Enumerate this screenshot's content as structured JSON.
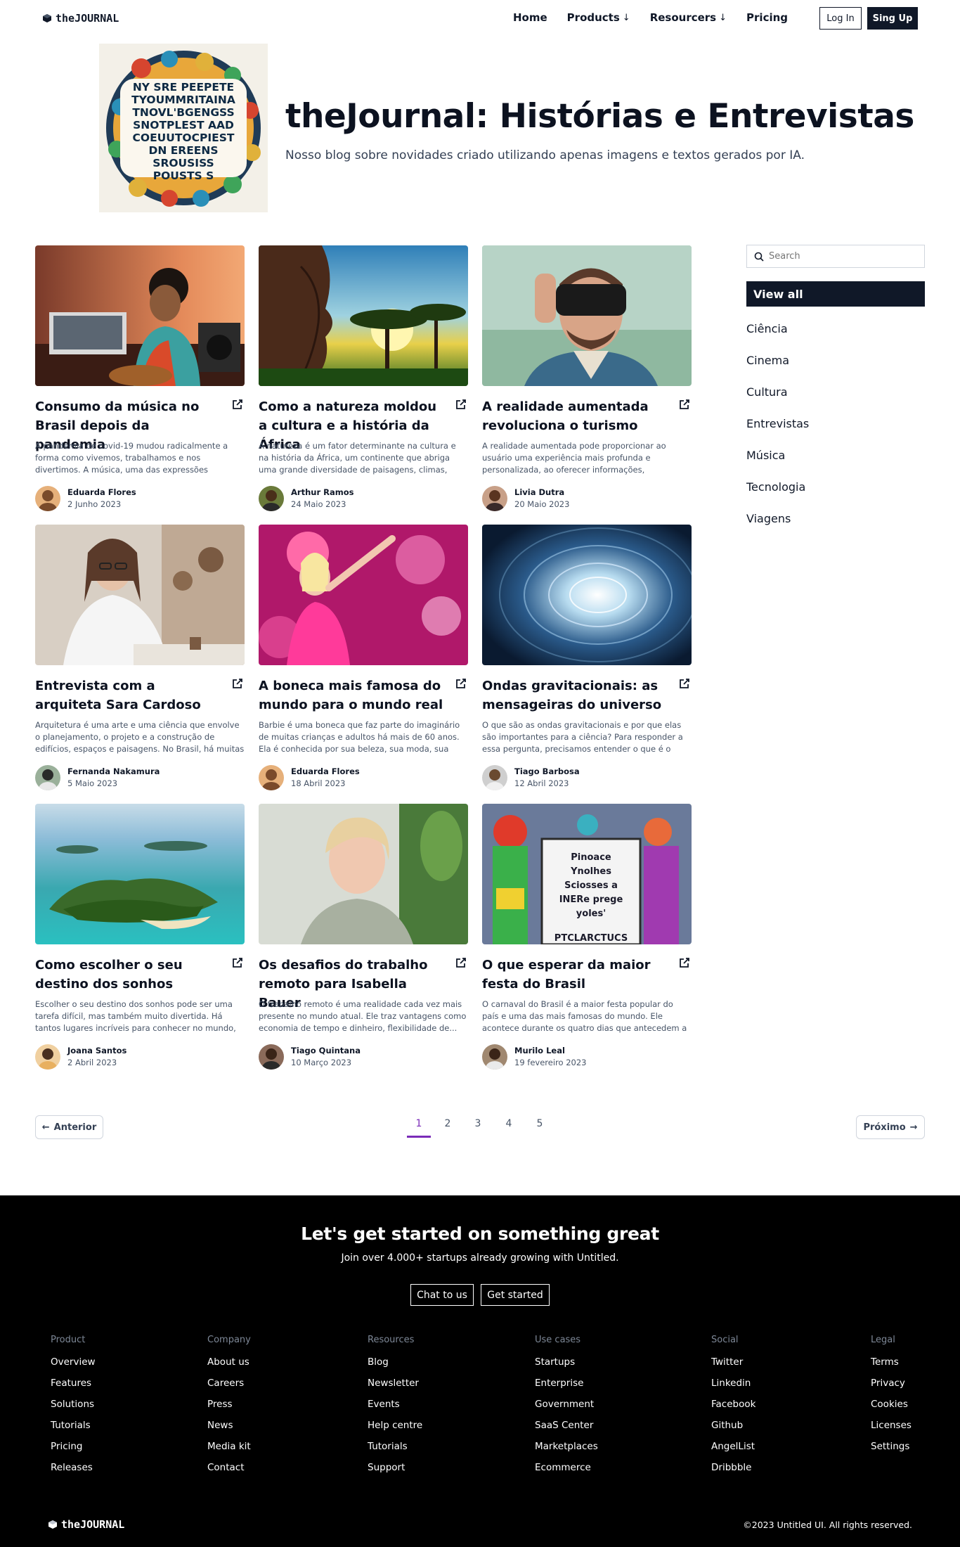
{
  "brand": {
    "name": "theJOURNAL"
  },
  "nav": {
    "links": [
      {
        "label": "Home",
        "has_dropdown": false
      },
      {
        "label": "Products",
        "has_dropdown": true
      },
      {
        "label": "Resourcers",
        "has_dropdown": true
      },
      {
        "label": "Pricing",
        "has_dropdown": false
      }
    ],
    "login_label": "Log In",
    "signup_label": "Sing Up"
  },
  "hero": {
    "title": "theJournal: Histórias e Entrevistas",
    "subtitle": "Nosso blog sobre novidades criado utilizando apenas imagens e textos gerados por IA.",
    "poster_lines": [
      "NY SRE PEEPETE",
      "TYOUMMRITAINA",
      "TNOVL'BGENGSS",
      "SNOTPLEST AAD",
      "COEUUTOCPIEST",
      "DN EREENS",
      "SROUSISS",
      "POUSTS S"
    ]
  },
  "posts": [
    {
      "title": "Consumo da música no Brasil depois da pandemia",
      "excerpt": "A pandemia de covid-19 mudou radicalmente a forma como vivemos, trabalhamos e nos divertimos. A música, uma das expressões artísticas mais...",
      "author": "Eduarda Flores",
      "date": "2 Junho 2023",
      "image": "musician-studio"
    },
    {
      "title": "Como a natureza moldou a cultura e a história da África",
      "excerpt": "A natureza é um fator determinante na cultura e na história da África, um continente que abriga uma grande diversidade de paisagens, climas, recursos...",
      "author": "Arthur Ramos",
      "date": "24 Maio 2023",
      "image": "african-mask-savanna"
    },
    {
      "title": "A realidade aumentada revoluciona o turismo",
      "excerpt": "A realidade aumentada pode proporcionar ao usuário uma experiência mais profunda e personalizada, ao oferecer informações, curiosidade...",
      "author": "Livia Dutra",
      "date": "20 Maio 2023",
      "image": "vr-headset-man"
    },
    {
      "title": "Entrevista com a arquiteta Sara Cardoso",
      "excerpt": "Arquitetura é uma arte e uma ciência que envolve o planejamento, o projeto e a construção de edifícios, espaços e paisagens. No Brasil, há muitas arquitetas...",
      "author": "Fernanda Nakamura",
      "date": "5 Maio 2023",
      "image": "architect-desk"
    },
    {
      "title": "A boneca mais famosa do mundo para o mundo real",
      "excerpt": "Barbie é uma boneca que faz parte do imaginário de muitas crianças e adultos há mais de 60 anos. Ela é conhecida por sua beleza, sua moda, sua diversidad...",
      "author": "Eduarda Flores",
      "date": "18 Abril 2023",
      "image": "pink-doll"
    },
    {
      "title": "Ondas gravitacionais: as mensageiras do universo",
      "excerpt": "O que são as ondas gravitacionais e por que elas são importantes para a ciência? Para responder a essa pergunta, precisamos entender o que é o espaço-...",
      "author": "Tiago Barbosa",
      "date": "12 Abril 2023",
      "image": "spiral-galaxy"
    },
    {
      "title": "Como escolher o seu destino dos sonhos",
      "excerpt": "Escolher o seu destino dos sonhos pode ser uma tarefa difícil, mas também muito divertida. Há tantos lugares incríveis para conhecer no mundo, que às...",
      "author": "Joana Santos",
      "date": "2 Abril 2023",
      "image": "tropical-island"
    },
    {
      "title": "Os desafios do trabalho remoto para Isabella Bauer",
      "excerpt": "O trabalho remoto é uma realidade cada vez mais presente no mundo atual. Ele traz vantagens como economia de tempo e dinheiro, flexibilidade de...",
      "author": "Tiago Quintana",
      "date": "10 Março 2023",
      "image": "woman-portrait"
    },
    {
      "title": "O que esperar da maior festa do Brasil",
      "excerpt": "O carnaval do Brasil é a maior festa popular do país e uma das mais famosas do mundo. Ele acontece durante os quatro dias que antecedem a quarta-...",
      "author": "Murilo Leal",
      "date": "19 fevereiro 2023",
      "image": "carnival-parade",
      "sign_lines": [
        "Pinoace",
        "Ynolhes",
        "Sciosses a",
        "INERe prege",
        "yoles'",
        "PTCLARCTUCS"
      ]
    }
  ],
  "sidebar": {
    "search_placeholder": "Search",
    "active_category": "View all",
    "categories": [
      "Ciência",
      "Cinema",
      "Cultura",
      "Entrevistas",
      "Música",
      "Tecnologia",
      "Viagens"
    ]
  },
  "pagination": {
    "prev_label": "Anterior",
    "next_label": "Próximo",
    "pages": [
      "1",
      "2",
      "3",
      "4",
      "5"
    ],
    "current": "1"
  },
  "footer": {
    "cta_title": "Let's get started on something great",
    "cta_subtitle": "Join over 4.000+ startups already growing with Untitled.",
    "chat_label": "Chat to us",
    "start_label": "Get started",
    "columns": [
      {
        "heading": "Product",
        "links": [
          "Overview",
          "Features",
          "Solutions",
          "Tutorials",
          "Pricing",
          "Releases"
        ]
      },
      {
        "heading": "Company",
        "links": [
          "About us",
          "Careers",
          "Press",
          "News",
          "Media kit",
          "Contact"
        ]
      },
      {
        "heading": "Resources",
        "links": [
          "Blog",
          "Newsletter",
          "Events",
          "Help centre",
          "Tutorials",
          "Support"
        ]
      },
      {
        "heading": "Use cases",
        "links": [
          "Startups",
          "Enterprise",
          "Government",
          "SaaS Center",
          "Marketplaces",
          "Ecommerce"
        ]
      },
      {
        "heading": "Social",
        "links": [
          "Twitter",
          "Linkedin",
          "Facebook",
          "Github",
          "AngelList",
          "Dribbble"
        ]
      },
      {
        "heading": "Legal",
        "links": [
          "Terms",
          "Privacy",
          "Cookies",
          "Licenses",
          "Settings"
        ]
      }
    ],
    "copyright": "©2023 Untitled UI. All rights reserved."
  },
  "colors": {
    "primary": "#101828",
    "accent": "#7a2bb8",
    "footer_bg": "#000000"
  }
}
